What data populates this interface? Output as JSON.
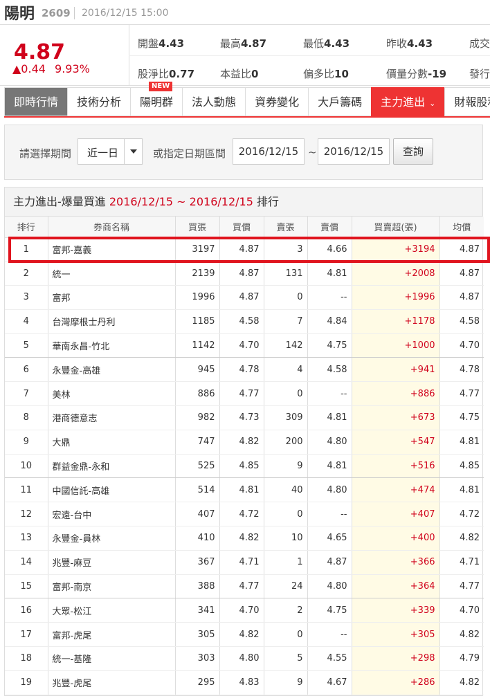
{
  "header": {
    "name": "陽明",
    "code": "2609",
    "datetime": "2016/12/15 15:00"
  },
  "quote": {
    "price": "4.87",
    "change": "▲0.44",
    "change_pct": "9.93%",
    "stats": {
      "open_label": "開盤",
      "open_value": "4.43",
      "high_label": "最高",
      "high_value": "4.87",
      "low_label": "最低",
      "low_value": "4.43",
      "prev_label": "昨收",
      "prev_value": "4.43",
      "vol_label": "成交",
      "pb_label": "股淨比",
      "pb_value": "0.77",
      "pe_label": "本益比",
      "pe_value": "0",
      "bias_label": "偏多比",
      "bias_value": "10",
      "pvscore_label": "價量分數",
      "pvscore_value": "-19",
      "issue_label": "發行"
    }
  },
  "tabs": [
    {
      "label": "即時行情"
    },
    {
      "label": "技術分析"
    },
    {
      "label": "陽明群",
      "badge": "NEW"
    },
    {
      "label": "法人動態"
    },
    {
      "label": "資券變化"
    },
    {
      "label": "大戶籌碼"
    },
    {
      "label": "主力進出"
    },
    {
      "label": "財報股利"
    }
  ],
  "filter": {
    "period_label": "請選擇期間",
    "period_value": "近一日",
    "range_label": "或指定日期區間",
    "start_date": "2016/12/15",
    "tilde": "~",
    "end_date": "2016/12/15",
    "query_button": "查詢"
  },
  "ranking": {
    "title_prefix": "主力進出-爆量買進",
    "title_range": "2016/12/15 ~ 2016/12/15",
    "title_suffix": "排行",
    "columns": [
      "排行",
      "券商名稱",
      "買張",
      "買價",
      "賣張",
      "賣價",
      "買賣超(張)",
      "均價"
    ],
    "rows": [
      {
        "rank": "1",
        "broker": "富邦-嘉義",
        "buy": "3197",
        "bprice": "4.87",
        "sell": "3",
        "sprice": "4.66",
        "net": "+3194",
        "avg": "4.87"
      },
      {
        "rank": "2",
        "broker": "統一",
        "buy": "2139",
        "bprice": "4.87",
        "sell": "131",
        "sprice": "4.81",
        "net": "+2008",
        "avg": "4.87"
      },
      {
        "rank": "3",
        "broker": "富邦",
        "buy": "1996",
        "bprice": "4.87",
        "sell": "0",
        "sprice": "--",
        "net": "+1996",
        "avg": "4.87"
      },
      {
        "rank": "4",
        "broker": "台灣摩根士丹利",
        "buy": "1185",
        "bprice": "4.58",
        "sell": "7",
        "sprice": "4.84",
        "net": "+1178",
        "avg": "4.58"
      },
      {
        "rank": "5",
        "broker": "華南永昌-竹北",
        "buy": "1142",
        "bprice": "4.70",
        "sell": "142",
        "sprice": "4.75",
        "net": "+1000",
        "avg": "4.70"
      },
      {
        "rank": "6",
        "broker": "永豐金-高雄",
        "buy": "945",
        "bprice": "4.78",
        "sell": "4",
        "sprice": "4.58",
        "net": "+941",
        "avg": "4.78"
      },
      {
        "rank": "7",
        "broker": "美林",
        "buy": "886",
        "bprice": "4.77",
        "sell": "0",
        "sprice": "--",
        "net": "+886",
        "avg": "4.77"
      },
      {
        "rank": "8",
        "broker": "港商德意志",
        "buy": "982",
        "bprice": "4.73",
        "sell": "309",
        "sprice": "4.81",
        "net": "+673",
        "avg": "4.75"
      },
      {
        "rank": "9",
        "broker": "大鼎",
        "buy": "747",
        "bprice": "4.82",
        "sell": "200",
        "sprice": "4.80",
        "net": "+547",
        "avg": "4.81"
      },
      {
        "rank": "10",
        "broker": "群益金鼎-永和",
        "buy": "525",
        "bprice": "4.85",
        "sell": "9",
        "sprice": "4.81",
        "net": "+516",
        "avg": "4.85"
      },
      {
        "rank": "11",
        "broker": "中國信託-高雄",
        "buy": "514",
        "bprice": "4.81",
        "sell": "40",
        "sprice": "4.80",
        "net": "+474",
        "avg": "4.81"
      },
      {
        "rank": "12",
        "broker": "宏遠-台中",
        "buy": "407",
        "bprice": "4.72",
        "sell": "0",
        "sprice": "--",
        "net": "+407",
        "avg": "4.72"
      },
      {
        "rank": "13",
        "broker": "永豐金-員林",
        "buy": "410",
        "bprice": "4.82",
        "sell": "10",
        "sprice": "4.65",
        "net": "+400",
        "avg": "4.82"
      },
      {
        "rank": "14",
        "broker": "兆豐-麻豆",
        "buy": "367",
        "bprice": "4.71",
        "sell": "1",
        "sprice": "4.87",
        "net": "+366",
        "avg": "4.71"
      },
      {
        "rank": "15",
        "broker": "富邦-南京",
        "buy": "388",
        "bprice": "4.77",
        "sell": "24",
        "sprice": "4.80",
        "net": "+364",
        "avg": "4.77"
      },
      {
        "rank": "16",
        "broker": "大眾-松江",
        "buy": "341",
        "bprice": "4.70",
        "sell": "2",
        "sprice": "4.75",
        "net": "+339",
        "avg": "4.70"
      },
      {
        "rank": "17",
        "broker": "富邦-虎尾",
        "buy": "305",
        "bprice": "4.82",
        "sell": "0",
        "sprice": "--",
        "net": "+305",
        "avg": "4.82"
      },
      {
        "rank": "18",
        "broker": "統一-基隆",
        "buy": "303",
        "bprice": "4.80",
        "sell": "5",
        "sprice": "4.55",
        "net": "+298",
        "avg": "4.79"
      },
      {
        "rank": "19",
        "broker": "兆豐-虎尾",
        "buy": "295",
        "bprice": "4.83",
        "sell": "9",
        "sprice": "4.67",
        "net": "+286",
        "avg": "4.82"
      }
    ]
  }
}
